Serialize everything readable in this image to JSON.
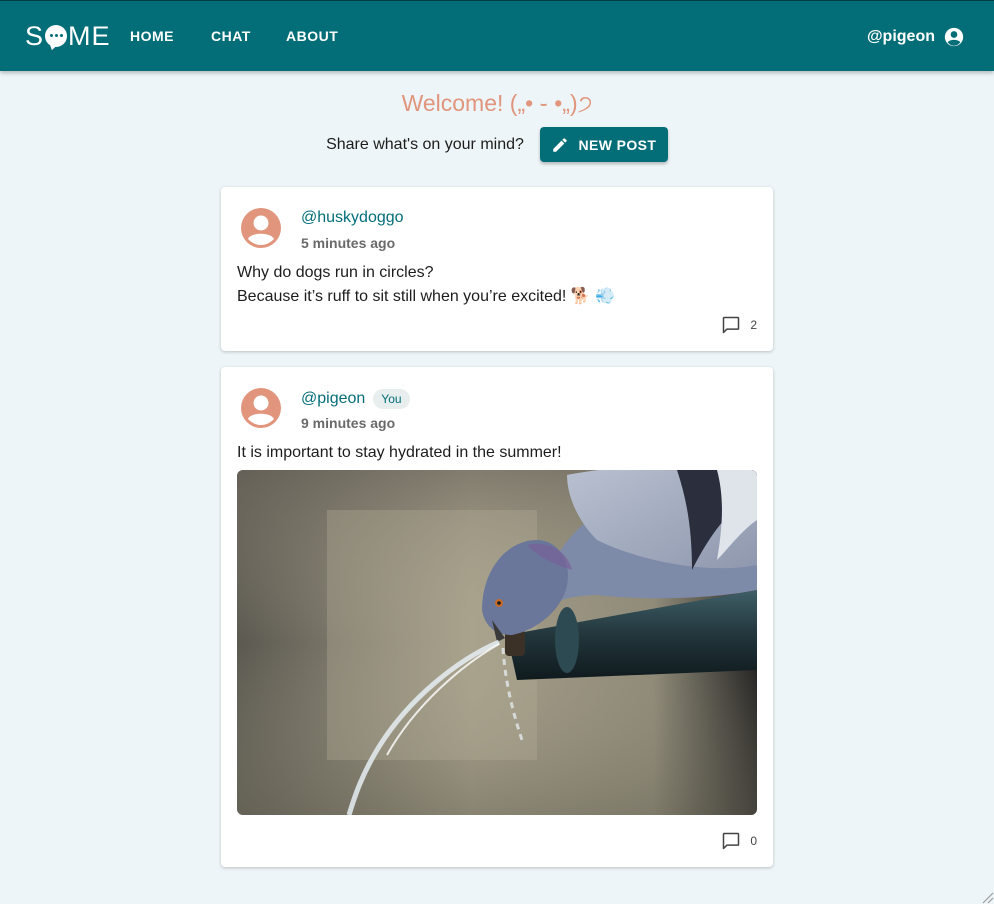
{
  "header": {
    "logo_text": "SOME",
    "nav": [
      "HOME",
      "CHAT",
      "ABOUT"
    ],
    "username": "@pigeon",
    "user_icon": "account-circle-icon"
  },
  "welcome": {
    "title": "Welcome!  („• ֊ •„)੭",
    "prompt": "Share what's on your mind?",
    "new_post_label": "NEW POST",
    "new_post_icon": "pencil-icon"
  },
  "posts": [
    {
      "author": "@huskydoggo",
      "time": "5 minutes ago",
      "text_line1": "Why do dogs run in circles?",
      "text_line2": "Because it’s ruff to sit still when you’re excited! 🐕 💨",
      "comments": "2",
      "is_you": false
    },
    {
      "author": "@pigeon",
      "badge": "You",
      "time": "9 minutes ago",
      "text_line1": "It is important to stay hydrated in the summer!",
      "image": "pigeon drinking from fountain photo",
      "comments": "0",
      "is_you": true
    }
  ],
  "colors": {
    "primary": "#046e78",
    "accent": "#e0957c",
    "background": "#eef5f8"
  }
}
